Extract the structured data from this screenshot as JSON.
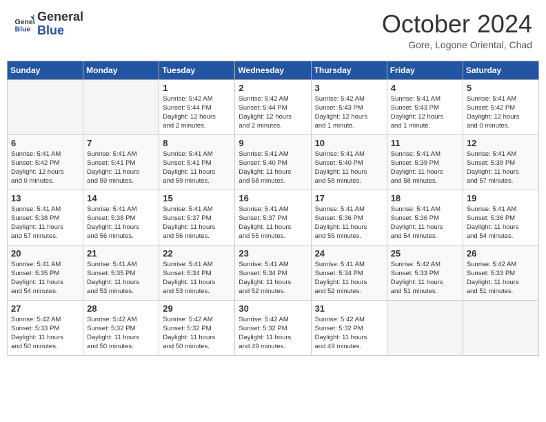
{
  "header": {
    "logo_line1": "General",
    "logo_line2": "Blue",
    "month": "October 2024",
    "location": "Gore, Logone Oriental, Chad"
  },
  "days_of_week": [
    "Sunday",
    "Monday",
    "Tuesday",
    "Wednesday",
    "Thursday",
    "Friday",
    "Saturday"
  ],
  "weeks": [
    [
      {
        "day": "",
        "info": "",
        "empty": true
      },
      {
        "day": "",
        "info": "",
        "empty": true
      },
      {
        "day": "1",
        "info": "Sunrise: 5:42 AM\nSunset: 5:44 PM\nDaylight: 12 hours\nand 2 minutes."
      },
      {
        "day": "2",
        "info": "Sunrise: 5:42 AM\nSunset: 5:44 PM\nDaylight: 12 hours\nand 2 minutes."
      },
      {
        "day": "3",
        "info": "Sunrise: 5:42 AM\nSunset: 5:43 PM\nDaylight: 12 hours\nand 1 minute."
      },
      {
        "day": "4",
        "info": "Sunrise: 5:41 AM\nSunset: 5:43 PM\nDaylight: 12 hours\nand 1 minute."
      },
      {
        "day": "5",
        "info": "Sunrise: 5:41 AM\nSunset: 5:42 PM\nDaylight: 12 hours\nand 0 minutes."
      }
    ],
    [
      {
        "day": "6",
        "info": "Sunrise: 5:41 AM\nSunset: 5:42 PM\nDaylight: 12 hours\nand 0 minutes."
      },
      {
        "day": "7",
        "info": "Sunrise: 5:41 AM\nSunset: 5:41 PM\nDaylight: 11 hours\nand 59 minutes."
      },
      {
        "day": "8",
        "info": "Sunrise: 5:41 AM\nSunset: 5:41 PM\nDaylight: 11 hours\nand 59 minutes."
      },
      {
        "day": "9",
        "info": "Sunrise: 5:41 AM\nSunset: 5:40 PM\nDaylight: 11 hours\nand 58 minutes."
      },
      {
        "day": "10",
        "info": "Sunrise: 5:41 AM\nSunset: 5:40 PM\nDaylight: 11 hours\nand 58 minutes."
      },
      {
        "day": "11",
        "info": "Sunrise: 5:41 AM\nSunset: 5:39 PM\nDaylight: 11 hours\nand 58 minutes."
      },
      {
        "day": "12",
        "info": "Sunrise: 5:41 AM\nSunset: 5:39 PM\nDaylight: 11 hours\nand 57 minutes."
      }
    ],
    [
      {
        "day": "13",
        "info": "Sunrise: 5:41 AM\nSunset: 5:38 PM\nDaylight: 11 hours\nand 57 minutes."
      },
      {
        "day": "14",
        "info": "Sunrise: 5:41 AM\nSunset: 5:38 PM\nDaylight: 11 hours\nand 56 minutes."
      },
      {
        "day": "15",
        "info": "Sunrise: 5:41 AM\nSunset: 5:37 PM\nDaylight: 11 hours\nand 56 minutes."
      },
      {
        "day": "16",
        "info": "Sunrise: 5:41 AM\nSunset: 5:37 PM\nDaylight: 11 hours\nand 55 minutes."
      },
      {
        "day": "17",
        "info": "Sunrise: 5:41 AM\nSunset: 5:36 PM\nDaylight: 11 hours\nand 55 minutes."
      },
      {
        "day": "18",
        "info": "Sunrise: 5:41 AM\nSunset: 5:36 PM\nDaylight: 11 hours\nand 54 minutes."
      },
      {
        "day": "19",
        "info": "Sunrise: 5:41 AM\nSunset: 5:36 PM\nDaylight: 11 hours\nand 54 minutes."
      }
    ],
    [
      {
        "day": "20",
        "info": "Sunrise: 5:41 AM\nSunset: 5:35 PM\nDaylight: 11 hours\nand 54 minutes."
      },
      {
        "day": "21",
        "info": "Sunrise: 5:41 AM\nSunset: 5:35 PM\nDaylight: 11 hours\nand 53 minutes."
      },
      {
        "day": "22",
        "info": "Sunrise: 5:41 AM\nSunset: 5:34 PM\nDaylight: 11 hours\nand 53 minutes."
      },
      {
        "day": "23",
        "info": "Sunrise: 5:41 AM\nSunset: 5:34 PM\nDaylight: 11 hours\nand 52 minutes."
      },
      {
        "day": "24",
        "info": "Sunrise: 5:41 AM\nSunset: 5:34 PM\nDaylight: 11 hours\nand 52 minutes."
      },
      {
        "day": "25",
        "info": "Sunrise: 5:42 AM\nSunset: 5:33 PM\nDaylight: 11 hours\nand 51 minutes."
      },
      {
        "day": "26",
        "info": "Sunrise: 5:42 AM\nSunset: 5:33 PM\nDaylight: 11 hours\nand 51 minutes."
      }
    ],
    [
      {
        "day": "27",
        "info": "Sunrise: 5:42 AM\nSunset: 5:33 PM\nDaylight: 11 hours\nand 50 minutes."
      },
      {
        "day": "28",
        "info": "Sunrise: 5:42 AM\nSunset: 5:32 PM\nDaylight: 11 hours\nand 50 minutes."
      },
      {
        "day": "29",
        "info": "Sunrise: 5:42 AM\nSunset: 5:32 PM\nDaylight: 11 hours\nand 50 minutes."
      },
      {
        "day": "30",
        "info": "Sunrise: 5:42 AM\nSunset: 5:32 PM\nDaylight: 11 hours\nand 49 minutes."
      },
      {
        "day": "31",
        "info": "Sunrise: 5:42 AM\nSunset: 5:32 PM\nDaylight: 11 hours\nand 49 minutes."
      },
      {
        "day": "",
        "info": "",
        "empty": true
      },
      {
        "day": "",
        "info": "",
        "empty": true
      }
    ]
  ]
}
